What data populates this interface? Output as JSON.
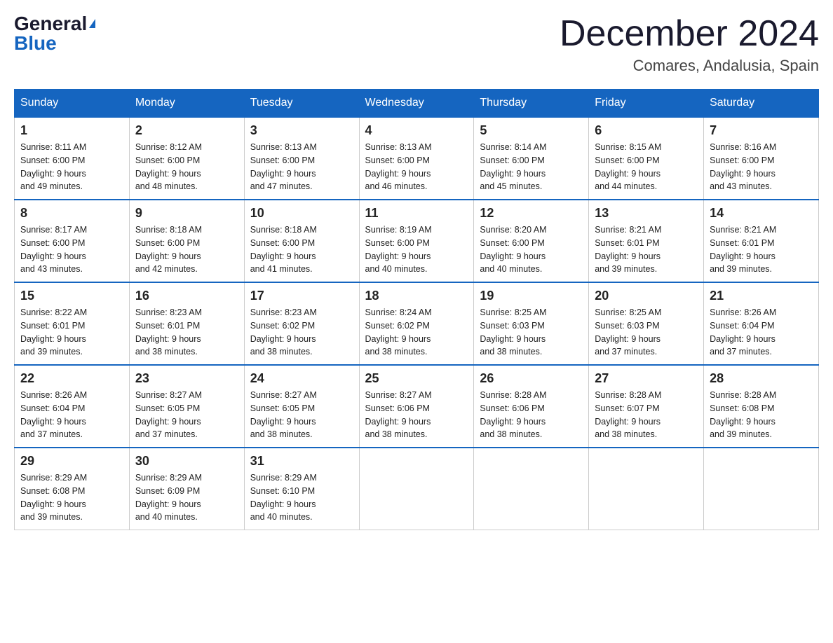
{
  "header": {
    "logo_general": "General",
    "logo_blue": "Blue",
    "month_title": "December 2024",
    "location": "Comares, Andalusia, Spain"
  },
  "weekdays": [
    "Sunday",
    "Monday",
    "Tuesday",
    "Wednesday",
    "Thursday",
    "Friday",
    "Saturday"
  ],
  "weeks": [
    [
      {
        "day": "1",
        "sunrise": "8:11 AM",
        "sunset": "6:00 PM",
        "daylight": "9 hours and 49 minutes."
      },
      {
        "day": "2",
        "sunrise": "8:12 AM",
        "sunset": "6:00 PM",
        "daylight": "9 hours and 48 minutes."
      },
      {
        "day": "3",
        "sunrise": "8:13 AM",
        "sunset": "6:00 PM",
        "daylight": "9 hours and 47 minutes."
      },
      {
        "day": "4",
        "sunrise": "8:13 AM",
        "sunset": "6:00 PM",
        "daylight": "9 hours and 46 minutes."
      },
      {
        "day": "5",
        "sunrise": "8:14 AM",
        "sunset": "6:00 PM",
        "daylight": "9 hours and 45 minutes."
      },
      {
        "day": "6",
        "sunrise": "8:15 AM",
        "sunset": "6:00 PM",
        "daylight": "9 hours and 44 minutes."
      },
      {
        "day": "7",
        "sunrise": "8:16 AM",
        "sunset": "6:00 PM",
        "daylight": "9 hours and 43 minutes."
      }
    ],
    [
      {
        "day": "8",
        "sunrise": "8:17 AM",
        "sunset": "6:00 PM",
        "daylight": "9 hours and 43 minutes."
      },
      {
        "day": "9",
        "sunrise": "8:18 AM",
        "sunset": "6:00 PM",
        "daylight": "9 hours and 42 minutes."
      },
      {
        "day": "10",
        "sunrise": "8:18 AM",
        "sunset": "6:00 PM",
        "daylight": "9 hours and 41 minutes."
      },
      {
        "day": "11",
        "sunrise": "8:19 AM",
        "sunset": "6:00 PM",
        "daylight": "9 hours and 40 minutes."
      },
      {
        "day": "12",
        "sunrise": "8:20 AM",
        "sunset": "6:00 PM",
        "daylight": "9 hours and 40 minutes."
      },
      {
        "day": "13",
        "sunrise": "8:21 AM",
        "sunset": "6:01 PM",
        "daylight": "9 hours and 39 minutes."
      },
      {
        "day": "14",
        "sunrise": "8:21 AM",
        "sunset": "6:01 PM",
        "daylight": "9 hours and 39 minutes."
      }
    ],
    [
      {
        "day": "15",
        "sunrise": "8:22 AM",
        "sunset": "6:01 PM",
        "daylight": "9 hours and 39 minutes."
      },
      {
        "day": "16",
        "sunrise": "8:23 AM",
        "sunset": "6:01 PM",
        "daylight": "9 hours and 38 minutes."
      },
      {
        "day": "17",
        "sunrise": "8:23 AM",
        "sunset": "6:02 PM",
        "daylight": "9 hours and 38 minutes."
      },
      {
        "day": "18",
        "sunrise": "8:24 AM",
        "sunset": "6:02 PM",
        "daylight": "9 hours and 38 minutes."
      },
      {
        "day": "19",
        "sunrise": "8:25 AM",
        "sunset": "6:03 PM",
        "daylight": "9 hours and 38 minutes."
      },
      {
        "day": "20",
        "sunrise": "8:25 AM",
        "sunset": "6:03 PM",
        "daylight": "9 hours and 37 minutes."
      },
      {
        "day": "21",
        "sunrise": "8:26 AM",
        "sunset": "6:04 PM",
        "daylight": "9 hours and 37 minutes."
      }
    ],
    [
      {
        "day": "22",
        "sunrise": "8:26 AM",
        "sunset": "6:04 PM",
        "daylight": "9 hours and 37 minutes."
      },
      {
        "day": "23",
        "sunrise": "8:27 AM",
        "sunset": "6:05 PM",
        "daylight": "9 hours and 37 minutes."
      },
      {
        "day": "24",
        "sunrise": "8:27 AM",
        "sunset": "6:05 PM",
        "daylight": "9 hours and 38 minutes."
      },
      {
        "day": "25",
        "sunrise": "8:27 AM",
        "sunset": "6:06 PM",
        "daylight": "9 hours and 38 minutes."
      },
      {
        "day": "26",
        "sunrise": "8:28 AM",
        "sunset": "6:06 PM",
        "daylight": "9 hours and 38 minutes."
      },
      {
        "day": "27",
        "sunrise": "8:28 AM",
        "sunset": "6:07 PM",
        "daylight": "9 hours and 38 minutes."
      },
      {
        "day": "28",
        "sunrise": "8:28 AM",
        "sunset": "6:08 PM",
        "daylight": "9 hours and 39 minutes."
      }
    ],
    [
      {
        "day": "29",
        "sunrise": "8:29 AM",
        "sunset": "6:08 PM",
        "daylight": "9 hours and 39 minutes."
      },
      {
        "day": "30",
        "sunrise": "8:29 AM",
        "sunset": "6:09 PM",
        "daylight": "9 hours and 40 minutes."
      },
      {
        "day": "31",
        "sunrise": "8:29 AM",
        "sunset": "6:10 PM",
        "daylight": "9 hours and 40 minutes."
      },
      null,
      null,
      null,
      null
    ]
  ]
}
